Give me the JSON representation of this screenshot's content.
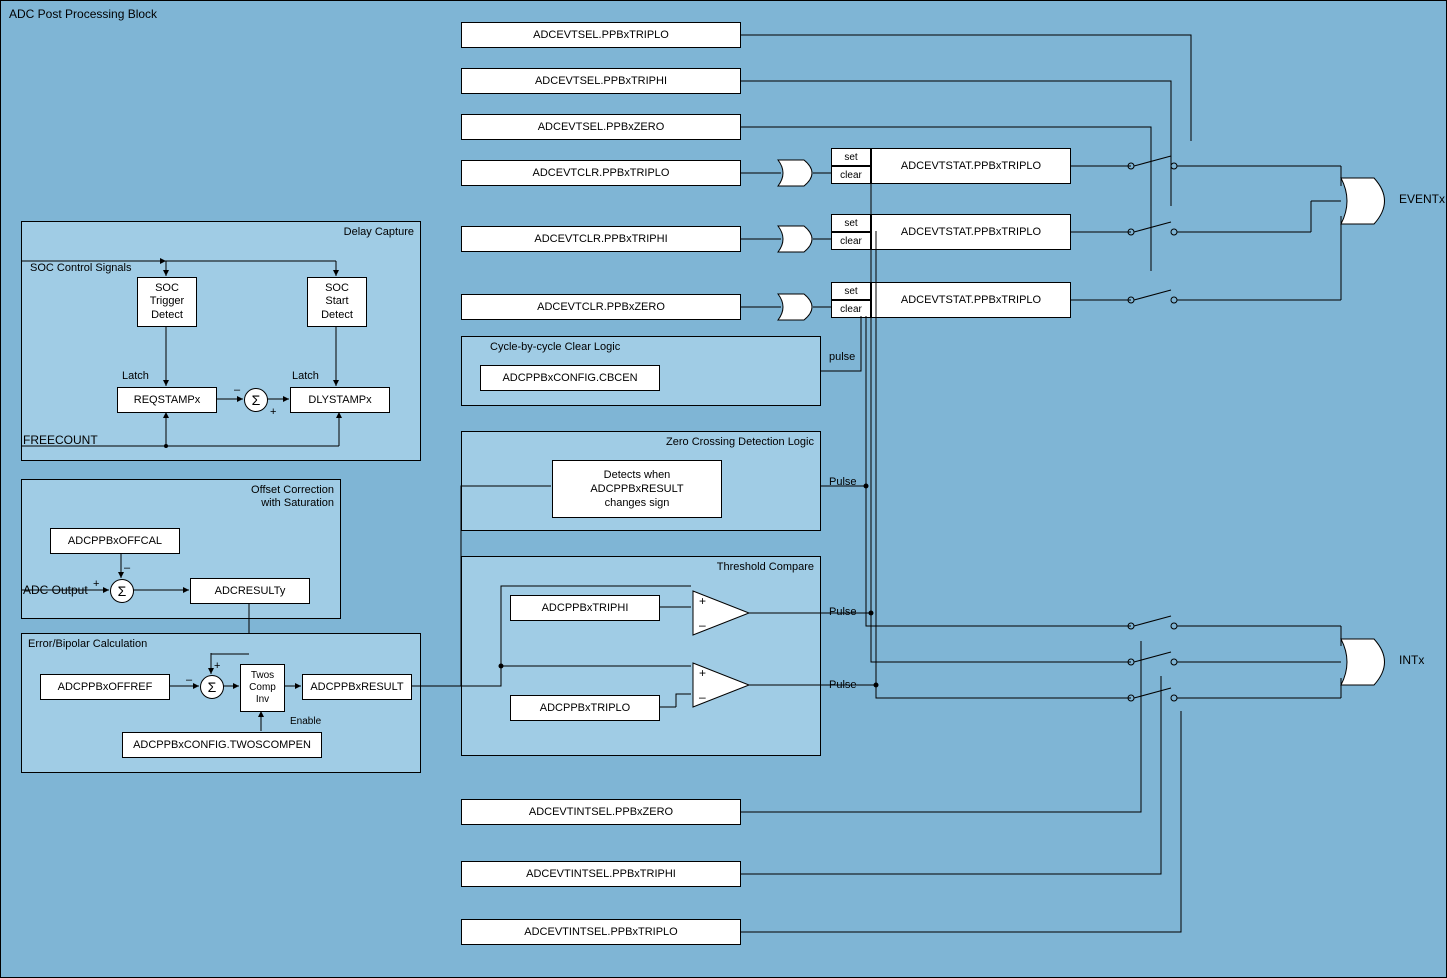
{
  "main_title": "ADC Post Processing Block",
  "delay_capture": {
    "title": "Delay Capture",
    "soc_signals": "SOC Control Signals",
    "soc_trigger": "SOC\nTrigger\nDetect",
    "soc_start": "SOC\nStart\nDetect",
    "latch1": "Latch",
    "latch2": "Latch",
    "reqstamp": "REQSTAMPx",
    "dlystamp": "DLYSTAMPx",
    "freecount": "FREECOUNT"
  },
  "offset": {
    "title": "Offset Correction\nwith Saturation",
    "offcal": "ADCPPBxOFFCAL",
    "adc_output": "ADC Output",
    "result": "ADCRESULTy"
  },
  "error": {
    "title": "Error/Bipolar Calculation",
    "offref": "ADCPPBxOFFREF",
    "twos": "Twos\nComp\nInv",
    "enable": "Enable",
    "twoscompen": "ADCPPBxCONFIG.TWOSCOMPEN",
    "result": "ADCPPBxRESULT"
  },
  "evtsel": {
    "triplo": "ADCEVTSEL.PPBxTRIPLO",
    "triphi": "ADCEVTSEL.PPBxTRIPHI",
    "zero": "ADCEVTSEL.PPBxZERO"
  },
  "evtclr": {
    "triplo": "ADCEVTCLR.PPBxTRIPLO",
    "triphi": "ADCEVTCLR.PPBxTRIPHI",
    "zero": "ADCEVTCLR.PPBxZERO"
  },
  "evtstat": {
    "triplo1": "ADCEVTSTAT.PPBxTRIPLO",
    "triplo2": "ADCEVTSTAT.PPBxTRIPLO",
    "triplo3": "ADCEVTSTAT.PPBxTRIPLO"
  },
  "cbc": {
    "title": "Cycle-by-cycle Clear Logic",
    "config": "ADCPPBxCONFIG.CBCEN",
    "pulse": "pulse"
  },
  "zero_crossing": {
    "title": "Zero Crossing Detection Logic",
    "text": "Detects when\nADCPPBxRESULT\nchanges sign",
    "pulse": "Pulse"
  },
  "threshold": {
    "title": "Threshold Compare",
    "triphi": "ADCPPBxTRIPHI",
    "triplo": "ADCPPBxTRIPLO",
    "pulse1": "Pulse",
    "pulse2": "Pulse"
  },
  "evtintsel": {
    "zero": "ADCEVTINTSEL.PPBxZERO",
    "triphi": "ADCEVTINTSEL.PPBxTRIPHI",
    "triplo": "ADCEVTINTSEL.PPBxTRIPLO"
  },
  "set": "set",
  "clear": "clear",
  "outputs": {
    "event": "EVENTx",
    "int": "INTx"
  },
  "signs": {
    "plus": "+",
    "minus": "–"
  }
}
